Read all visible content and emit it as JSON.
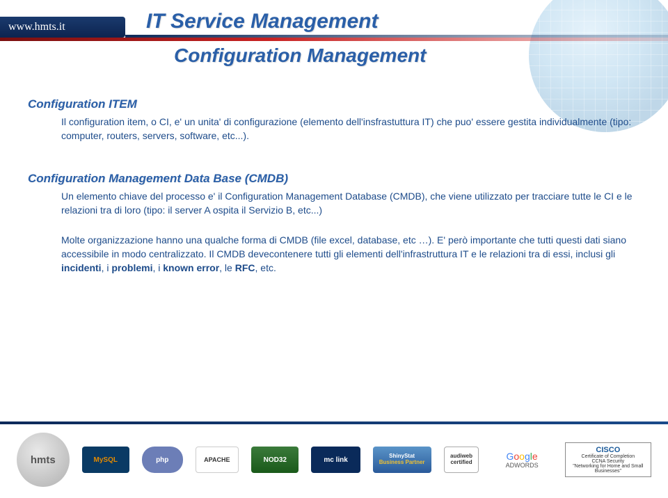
{
  "header": {
    "site_url": "www.hmts.it",
    "title": "IT  Service Management",
    "subtitle": "Configuration Management"
  },
  "section1": {
    "title": "Configuration ITEM",
    "body": "Il configuration item, o CI, e' un unita' di configurazione (elemento dell'insfrastuttura IT) che puo' essere gestita individualmente (tipo: computer, routers, servers, software, etc...)."
  },
  "section2": {
    "title": "Configuration Management Data Base (CMDB)",
    "para1": "Un elemento chiave del processo e' il Configuration Management Database (CMDB), che viene utilizzato per tracciare tutte le CI e le relazioni tra di loro (tipo: il server A ospita il Servizio B, etc...)",
    "para2_a": "Molte organizzazione hanno una qualche forma di CMDB (file excel, database, etc …). E' però importante che tutti questi dati siano accessibile in modo centralizzato. Il CMDB devecontenere tutti gli elementi dell'infrastruttura IT e le relazioni tra di essi, inclusi gli ",
    "b1": "incidenti",
    "sep1": ", i ",
    "b2": "problemi",
    "sep2": ", i ",
    "b3": "known error",
    "sep3": ", le ",
    "b4": "RFC",
    "sep4": ", etc."
  },
  "footer": {
    "mysql": "MySQL",
    "php": "php",
    "apache": "APACHE",
    "nod32": "NOD32",
    "mclink": "mc link",
    "shiny1": "ShinyStat",
    "shiny2": "Business Partner",
    "aud1": "audiweb",
    "aud2": "certified",
    "adwords": "ADWORDS",
    "cisco_brand": "CISCO",
    "cisco_l1": "Certificate of Completion",
    "cisco_l2": "CCNA Security",
    "cisco_l3": "\"Networking for Home and Small Businesses\""
  }
}
